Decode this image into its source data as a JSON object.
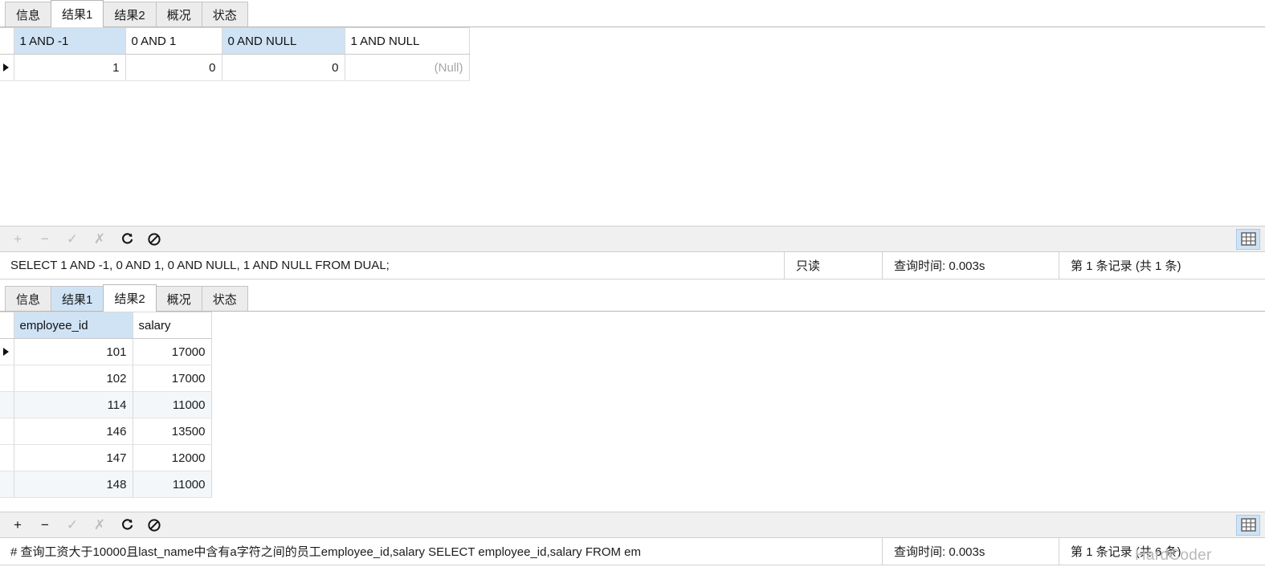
{
  "top_panel": {
    "tabs": [
      {
        "label": "信息",
        "state": "normal"
      },
      {
        "label": "结果1",
        "state": "active"
      },
      {
        "label": "结果2",
        "state": "normal"
      },
      {
        "label": "概况",
        "state": "normal"
      },
      {
        "label": "状态",
        "state": "normal"
      }
    ],
    "grid": {
      "columns": [
        "1 AND -1",
        "0 AND 1",
        "0 AND NULL",
        "1 AND NULL"
      ],
      "column_selected": [
        true,
        false,
        true,
        false
      ],
      "rows": [
        {
          "current": true,
          "cells": [
            "1",
            "0",
            "0",
            "(Null)"
          ],
          "null_flags": [
            false,
            false,
            false,
            true
          ]
        }
      ]
    },
    "toolbar": {
      "add": "+",
      "remove": "−",
      "confirm": "✓",
      "cancel": "✗",
      "refresh": "refresh",
      "stop": "stop",
      "grid_toggle": "grid-view"
    },
    "status": {
      "sql": "SELECT 1 AND -1, 0 AND 1, 0 AND NULL, 1 AND NULL FROM DUAL;",
      "readonly": "只读",
      "query_time": "查询时间: 0.003s",
      "records": "第 1 条记录 (共 1 条)"
    }
  },
  "bottom_panel": {
    "tabs": [
      {
        "label": "信息",
        "state": "normal"
      },
      {
        "label": "结果1",
        "state": "highlight"
      },
      {
        "label": "结果2",
        "state": "active"
      },
      {
        "label": "概况",
        "state": "normal"
      },
      {
        "label": "状态",
        "state": "normal"
      }
    ],
    "grid": {
      "columns": [
        "employee_id",
        "salary"
      ],
      "column_selected": [
        true,
        false
      ],
      "rows": [
        {
          "current": true,
          "alt": false,
          "cells": [
            "101",
            "17000"
          ]
        },
        {
          "current": false,
          "alt": false,
          "cells": [
            "102",
            "17000"
          ]
        },
        {
          "current": false,
          "alt": true,
          "cells": [
            "114",
            "11000"
          ]
        },
        {
          "current": false,
          "alt": false,
          "cells": [
            "146",
            "13500"
          ]
        },
        {
          "current": false,
          "alt": false,
          "cells": [
            "147",
            "12000"
          ]
        },
        {
          "current": false,
          "alt": true,
          "cells": [
            "148",
            "11000"
          ]
        }
      ]
    },
    "toolbar": {
      "add": "+",
      "remove": "−",
      "confirm": "✓",
      "cancel": "✗",
      "refresh": "refresh",
      "stop": "stop",
      "grid_toggle": "grid-view"
    },
    "status": {
      "sql": "# 查询工资大于10000且last_name中含有a字符之间的员工employee_id,salary SELECT employee_id,salary FROM em",
      "query_time": "查询时间: 0.003s",
      "records": "第 1 条记录 (共 6 条)"
    }
  },
  "watermark": {
    "text": "HardCoder"
  },
  "colors": {
    "selection_blue": "#cfe3f5",
    "alt_row": "#f4f7fa",
    "null_text": "#a6a6a6",
    "toolbar_bg": "#f0f0f0"
  }
}
